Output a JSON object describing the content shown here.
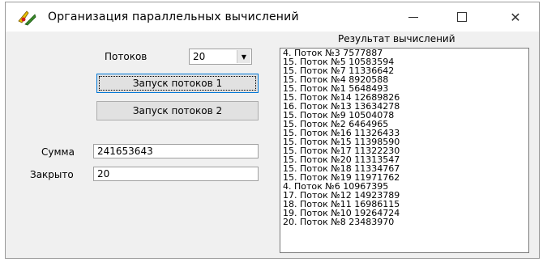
{
  "window": {
    "title": "Организация параллельных вычислений",
    "minimize_glyph": "",
    "maximize_glyph": "",
    "close_glyph": "✕"
  },
  "controls": {
    "threads_label": "Потоков",
    "threads_value": "20",
    "start1_label": "Запуск потоков 1",
    "start2_label": "Запуск потоков 2",
    "sum_label": "Сумма",
    "sum_value": "241653643",
    "closed_label": "Закрыто",
    "closed_value": "20"
  },
  "results": {
    "title": "Результат вычислений",
    "items": [
      "4. Поток №3  7577887",
      "15. Поток №5  10583594",
      "15. Поток №7  11336642",
      "15. Поток №4  8920588",
      "15. Поток №1  5648493",
      "15. Поток №14  12689826",
      "16. Поток №13  13634278",
      "15. Поток №9  10504078",
      "15. Поток №2  6464965",
      "15. Поток №16  11326433",
      "15. Поток №15  11398590",
      "15. Поток №17  11322230",
      "15. Поток №20  11313547",
      "15. Поток №18  11334767",
      "15. Поток №19  11971762",
      "4. Поток №6  10967395",
      "17. Поток №12  14923789",
      "18. Поток №11  16986115",
      "19. Поток №10  19264724",
      "20. Поток №8  23483970"
    ]
  }
}
